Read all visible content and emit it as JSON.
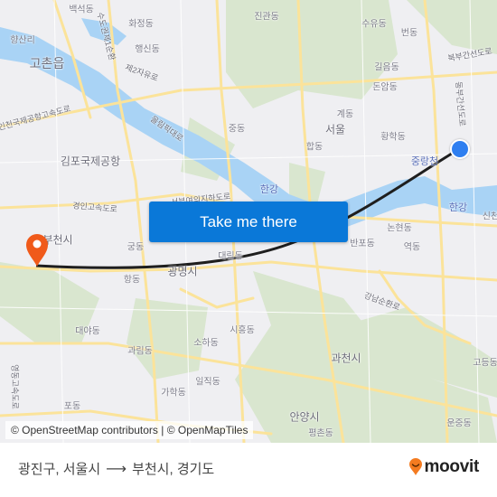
{
  "map": {
    "labels": {
      "baekseok": "백석동",
      "hwajeong": "화정동",
      "haengsin": "행신동",
      "hyangsan": "향산리",
      "gochon": "고촌읍",
      "jeyu": "제2자유로",
      "sudogwon": "수도권제1순환",
      "gimpo_rd": "인천국제공항고속도로",
      "olympic": "올림픽대로",
      "gimpo_airport": "김포국제공항",
      "gyeongin": "경인고속도로",
      "seobu": "서부여의지하도로",
      "jingwan": "진관동",
      "suyu": "수유동",
      "beon": "번동",
      "gireum": "길음동",
      "donam": "돈암동",
      "bukbu": "북부간선도로",
      "dongbu": "동부간선도로",
      "gye": "계동",
      "seoul": "서울",
      "hwanghak": "황학동",
      "hap": "합동",
      "jung": "중동",
      "jungnang": "중랑천",
      "hangang1": "한강",
      "hangang2": "한강",
      "sincheon": "신천",
      "bucheon": "부천시",
      "gung": "궁동",
      "hang": "항동",
      "gwangmyeong": "광명시",
      "daerim": "대림동",
      "nonhyeon": "논현동",
      "banpo": "반포동",
      "yeok": "역동",
      "gangnam": "강남순환로",
      "daea": "대야동",
      "siheung": "시흥동",
      "soha": "소하동",
      "gwarim": "과림동",
      "iljik": "일직동",
      "gahak": "가학동",
      "po": "포동",
      "yeongdong": "영동고속도로",
      "gwacheon": "과천시",
      "godeung": "고등동",
      "anyang": "안양시",
      "pyeongchon": "평촌동",
      "unjung": "운중동"
    },
    "attribution": "© OpenStreetMap contributors | © OpenMapTiles",
    "cta_label": "Take me there",
    "origin_icon": "origin-dot-icon",
    "destination_icon": "destination-pin-icon",
    "colors": {
      "route": "#1e1e1e",
      "water": "#a9d3f5",
      "park": "#d6e3cb",
      "road": "#fbe39a",
      "accent": "#0a78d8",
      "pin": "#f05a1a",
      "origin": "#2f7ff0"
    }
  },
  "footer": {
    "origin": "광진구, 서울시",
    "arrow": "⟶",
    "destination": "부천시, 경기도",
    "brand": "moovit"
  }
}
